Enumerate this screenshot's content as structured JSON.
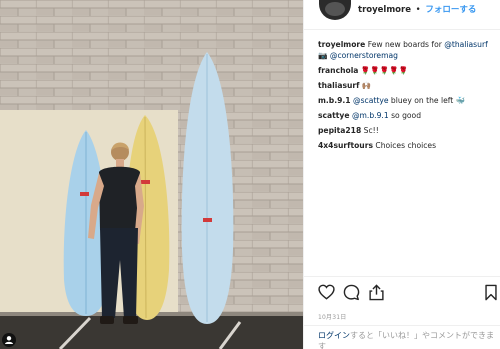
{
  "post": {
    "username": "troyelmore",
    "separator": "•",
    "follow_label": "フォローする",
    "date": "10月31日",
    "login_link": "ログイン",
    "login_text": "すると「いいね！」やコメントができます"
  },
  "comments": [
    {
      "user": "troyelmore",
      "parts": [
        {
          "t": "Few new boards for "
        },
        {
          "m": "@thaliasurf"
        },
        {
          "t": " 📷 "
        },
        {
          "m": "@cornerstoremag"
        }
      ]
    },
    {
      "user": "franchola",
      "parts": [
        {
          "t": "🌹🌹🌹🌹🌹"
        }
      ]
    },
    {
      "user": "thaliasurf",
      "parts": [
        {
          "t": "🙌🏽"
        }
      ]
    },
    {
      "user": "m.b.9.1",
      "parts": [
        {
          "m": "@scattye"
        },
        {
          "t": " bluey on the left 🐳"
        }
      ]
    },
    {
      "user": "scattye",
      "parts": [
        {
          "m": "@m.b.9.1"
        },
        {
          "t": " so good"
        }
      ]
    },
    {
      "user": "pepita218",
      "parts": [
        {
          "t": "Sc!!"
        }
      ]
    },
    {
      "user": "4x4surftours",
      "parts": [
        {
          "t": "Choices choices"
        }
      ]
    }
  ],
  "icons": {
    "like": "heart-icon",
    "comment": "comment-icon",
    "share": "share-icon",
    "save": "bookmark-icon"
  },
  "colors": {
    "link": "#3897f0",
    "mention": "#003569",
    "text": "#262626",
    "muted": "#999999",
    "board_blue": "#a9d1ea",
    "board_yellow": "#e7d27a",
    "board_tall": "#c3dcec",
    "wall": "#c7bfb6"
  }
}
